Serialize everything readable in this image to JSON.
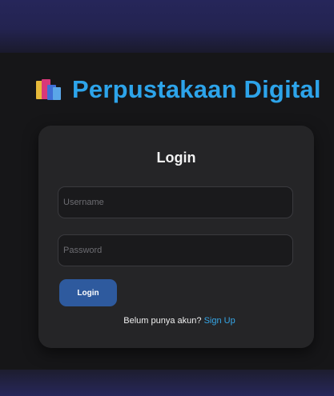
{
  "app": {
    "title": "Perpustakaan Digital",
    "accent_color": "#2da4ea",
    "icon": "books-icon"
  },
  "login_card": {
    "title": "Login",
    "username": {
      "placeholder": "Username",
      "value": ""
    },
    "password": {
      "placeholder": "Password",
      "value": ""
    },
    "submit_label": "Login",
    "submit_color": "#2e5a9e",
    "signup_prompt": "Belum punya akun?",
    "signup_link": "Sign Up",
    "link_color": "#36a7e8"
  }
}
